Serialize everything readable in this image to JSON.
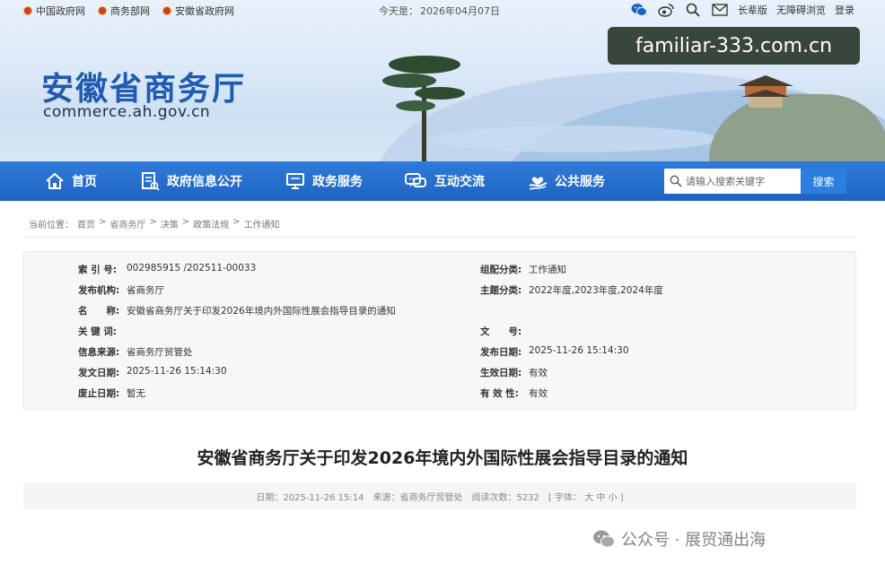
{
  "topbar": {
    "links": [
      {
        "label": "中国政府网"
      },
      {
        "label": "商务部网"
      },
      {
        "label": "安徽省政府网"
      }
    ],
    "today_label": "今天是：",
    "today_date": "2026年04月07日",
    "tools": {
      "icons": [
        "wechat-icon",
        "weibo-icon",
        "search-icon",
        "mail-icon"
      ],
      "elder_label": "长辈版",
      "barrier_free_label": "无障碍浏览",
      "login_label": "登录"
    }
  },
  "brand": {
    "name_cn": "安徽省商务厅",
    "domain": "commerce.ah.gov.cn"
  },
  "overlay_watermark": "familiar-333.com.cn",
  "nav": {
    "items": [
      {
        "label": "首页",
        "icon": "home-icon"
      },
      {
        "label": "政府信息公开",
        "icon": "document-icon"
      },
      {
        "label": "政务服务",
        "icon": "monitor-icon"
      },
      {
        "label": "互动交流",
        "icon": "chat-icon"
      },
      {
        "label": "公共服务",
        "icon": "hand-heart-icon"
      }
    ],
    "search": {
      "placeholder": "请输入搜索关键字",
      "button_label": "搜索"
    }
  },
  "breadcrumb": {
    "prefix": "当前位置：",
    "items": [
      "首页",
      "省商务厅",
      "决策",
      "政策法规",
      "工作通知"
    ],
    "separator": ">"
  },
  "info": {
    "index_no": {
      "label": "索 引 号:",
      "value": "002985915 /202511-00033"
    },
    "category": {
      "label": "组配分类:",
      "value": "工作通知"
    },
    "publisher": {
      "label": "发布机构:",
      "value": "省商务厅"
    },
    "topic": {
      "label": "主题分类:",
      "value": "2022年度,2023年度,2024年度"
    },
    "name": {
      "label": "名　　称:",
      "value": "安徽省商务厅关于印发2026年境内外国际性展会指导目录的通知"
    },
    "keywords": {
      "label": "关 键 词:",
      "value": ""
    },
    "doc_no": {
      "label": "文　　号:",
      "value": ""
    },
    "source": {
      "label": "信息来源:",
      "value": "省商务厅贸管处"
    },
    "release_date": {
      "label": "发布日期:",
      "value": "2025-11-26 15:14:30"
    },
    "issue_date": {
      "label": "发文日期:",
      "value": "2025-11-26 15:14:30"
    },
    "effective_date": {
      "label": "生效日期:",
      "value": "有效"
    },
    "abolish_date": {
      "label": "废止日期:",
      "value": "暂无"
    },
    "validity": {
      "label": "有 效 性:",
      "value": "有效"
    }
  },
  "article": {
    "title": "安徽省商务厅关于印发2026年境内外国际性展会指导目录的通知",
    "meta_date_label": "日期：",
    "meta_date": "2025-11-26 15:14",
    "meta_source_label": "来源：",
    "meta_source": "省商务厅贸管处",
    "meta_views_label": "阅读次数：",
    "meta_views": "5232",
    "font_size_label": "[ 字体：",
    "font_sizes": [
      "大",
      "中",
      "小"
    ],
    "font_size_close": "]"
  },
  "bottom_watermark": {
    "text": "公众号 · 展贸通出海"
  },
  "colors": {
    "nav_blue": "#1f63c2",
    "brand_blue": "#1e5bb1",
    "search_button": "#2a7fe0"
  }
}
